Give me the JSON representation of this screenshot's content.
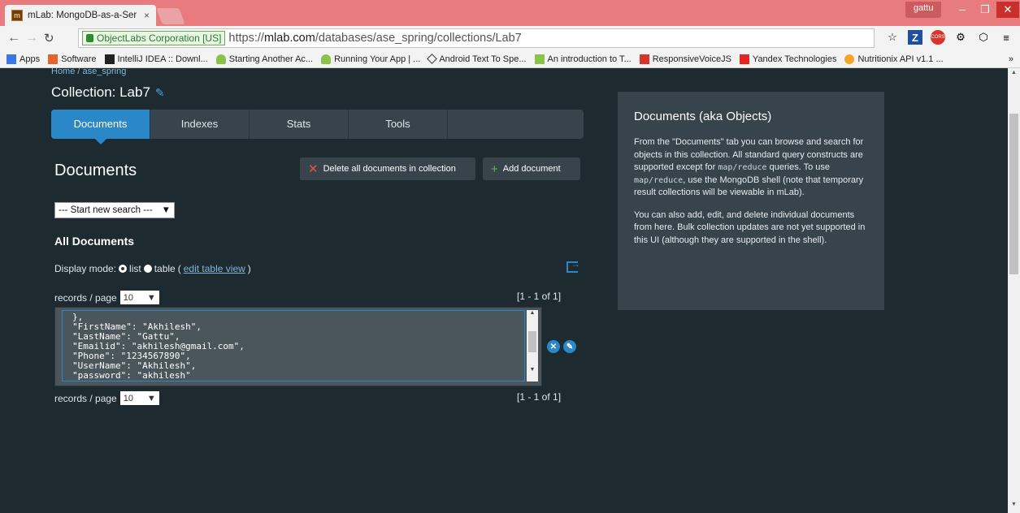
{
  "browser": {
    "tab_title": "mLab: MongoDB-as-a-Ser",
    "tab_close": "×",
    "user_badge": "gattu",
    "security_label": "ObjectLabs Corporation [US]",
    "url_prefix": "https://",
    "url_host": "mlab.com",
    "url_path": "/databases/ase_spring/collections/Lab7",
    "bookmarks": [
      "Apps",
      "Software",
      "IntelliJ IDEA :: Downl...",
      "Starting Another Ac...",
      "Running Your App | ...",
      "Android Text To Spe...",
      "An introduction to T...",
      "ResponsiveVoiceJS",
      "Yandex Technologies",
      "Nutritionix API v1.1 ..."
    ],
    "bookmarks_overflow": "»"
  },
  "page": {
    "breadcrumb": "Home / ase_spring",
    "collection_title": "Collection: Lab7",
    "tabs": [
      "Documents",
      "Indexes",
      "Stats",
      "Tools"
    ],
    "documents_heading": "Documents",
    "delete_all_label": "Delete all documents in collection",
    "add_document_label": "Add document",
    "search_select": "--- Start new search ---",
    "all_documents_heading": "All Documents",
    "display_mode_label": "Display mode:",
    "mode_list": "list",
    "mode_table": "table",
    "edit_table_view": "edit table view",
    "records_label": "records / page",
    "records_value": "10",
    "range_text": "[1 - 1 of 1]",
    "document_lines": [
      "},",
      "\"FirstName\": \"Akhilesh\",",
      "\"LastName\": \"Gattu\",",
      "\"Emailid\": \"akhilesh@gmail.com\",",
      "\"Phone\": \"1234567890\",",
      "\"UserName\": \"Akhilesh\",",
      "\"password\": \"akhilesh\""
    ]
  },
  "info": {
    "title": "Documents (aka Objects)",
    "p1_a": "From the \"Documents\" tab you can browse and search for objects in this collection. All standard query constructs are supported except for ",
    "p1_code1": "map/reduce",
    "p1_b": " queries. To use ",
    "p1_code2": "map/reduce",
    "p1_c": ", use the MongoDB shell (note that temporary result collections will be viewable in mLab).",
    "p2": "You can also add, edit, and delete individual documents from here. Bulk collection updates are not yet supported in this UI (although they are supported in the shell)."
  }
}
